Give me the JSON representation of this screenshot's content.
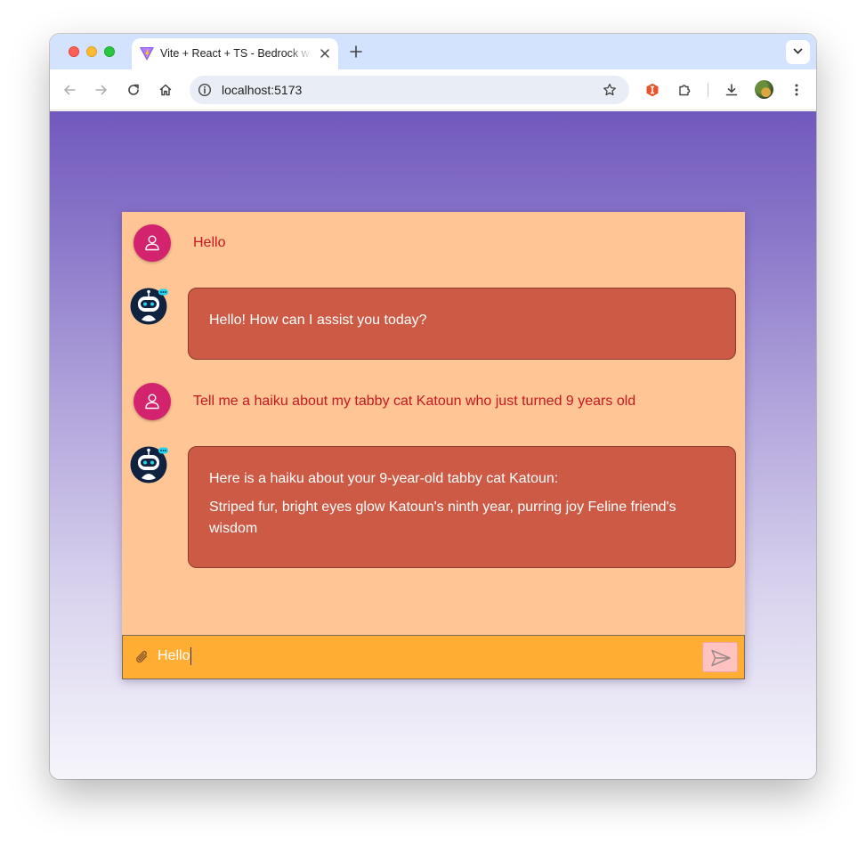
{
  "browser": {
    "tab_title": "Vite + React + TS - Bedrock with React",
    "url": "localhost:5173"
  },
  "chat": {
    "messages": [
      {
        "role": "user",
        "text": "Hello"
      },
      {
        "role": "assistant",
        "paragraphs": [
          "Hello! How can I assist you today?"
        ]
      },
      {
        "role": "user",
        "text": "Tell me a haiku about my tabby cat Katoun who just turned 9 years old"
      },
      {
        "role": "assistant",
        "paragraphs": [
          "Here is a haiku about your 9-year-old tabby cat Katoun:",
          "Striped fur, bright eyes glow Katoun's ninth year, purring joy Feline friend's wisdom"
        ]
      }
    ],
    "composer": {
      "value": "Hello",
      "attach_icon": "paperclip-icon",
      "send_icon": "send-icon"
    }
  },
  "colors": {
    "chat_background": "#ffc594",
    "assistant_bubble": "#cc5a45",
    "user_text": "#c41921",
    "user_avatar": "#d4236e",
    "composer": "#ffad33",
    "send_button": "#ffc2c0",
    "gradient_top": "#7159bd",
    "gradient_bottom": "#f6f5fb"
  }
}
